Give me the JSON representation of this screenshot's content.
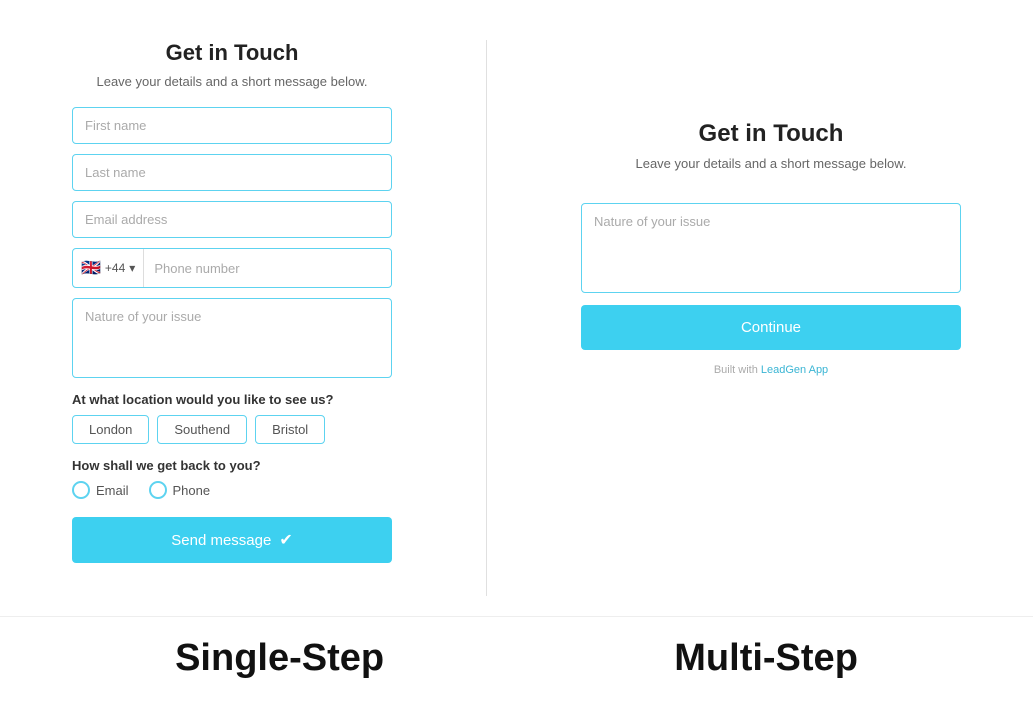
{
  "single_step": {
    "title": "Get in Touch",
    "subtitle": "Leave your details and a short message below.",
    "fields": {
      "first_name_placeholder": "First name",
      "last_name_placeholder": "Last name",
      "email_placeholder": "Email address",
      "phone_flag": "🇬🇧",
      "phone_code": "+44",
      "phone_dropdown": "▾",
      "phone_placeholder": "Phone number",
      "issue_placeholder": "Nature of your issue"
    },
    "location_question": "At what location would you like to see us?",
    "location_options": [
      "London",
      "Southend",
      "Bristol"
    ],
    "contact_question": "How shall we get back to you?",
    "contact_options": [
      "Email",
      "Phone"
    ],
    "send_button": "Send message"
  },
  "multi_step": {
    "title": "Get in Touch",
    "subtitle": "Leave your details and a short message below.",
    "issue_placeholder": "Nature of your issue",
    "continue_button": "Continue",
    "built_with_prefix": "Built with ",
    "built_with_link": "LeadGen App"
  },
  "labels": {
    "single_step_label": "Single-Step",
    "multi_step_label": "Multi-Step"
  }
}
